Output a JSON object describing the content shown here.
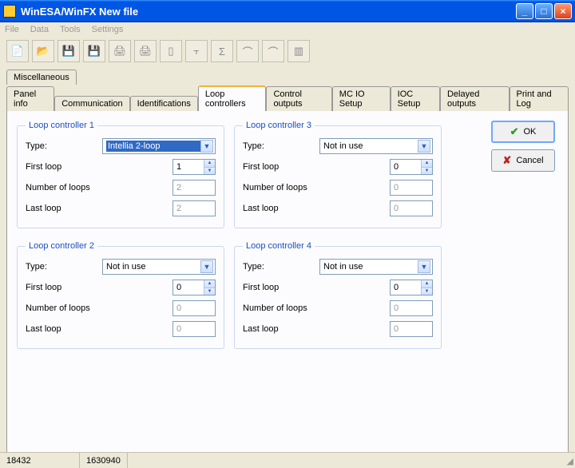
{
  "window": {
    "title": "WinESA/WinFX New file"
  },
  "menu": {
    "file": "File",
    "data": "Data",
    "tools": "Tools",
    "settings": "Settings"
  },
  "tabs_top": {
    "misc": "Miscellaneous"
  },
  "tabs": {
    "panel_info": "Panel info",
    "communication": "Communication",
    "identifications": "Identifications",
    "loop_controllers": "Loop controllers",
    "control_outputs": "Control outputs",
    "mc_io": "MC IO Setup",
    "ioc": "IOC Setup",
    "delayed": "Delayed outputs",
    "print_log": "Print and Log"
  },
  "labels": {
    "type": "Type:",
    "first_loop": "First loop",
    "num_loops": "Number of loops",
    "last_loop": "Last loop"
  },
  "controllers": [
    {
      "legend": "Loop controller 1",
      "type": "Intellia 2-loop",
      "active_sel": true,
      "first": "1",
      "num": "2",
      "last": "2",
      "num_disabled": true,
      "last_disabled": true
    },
    {
      "legend": "Loop controller 3",
      "type": "Not in use",
      "active_sel": false,
      "first": "0",
      "num": "0",
      "last": "0",
      "num_disabled": true,
      "last_disabled": true
    },
    {
      "legend": "Loop controller 2",
      "type": "Not in use",
      "active_sel": false,
      "first": "0",
      "num": "0",
      "last": "0",
      "num_disabled": true,
      "last_disabled": true
    },
    {
      "legend": "Loop controller 4",
      "type": "Not in use",
      "active_sel": false,
      "first": "0",
      "num": "0",
      "last": "0",
      "num_disabled": true,
      "last_disabled": true
    }
  ],
  "buttons": {
    "ok": "OK",
    "cancel": "Cancel"
  },
  "status": {
    "left": "18432",
    "right": "1630940"
  }
}
